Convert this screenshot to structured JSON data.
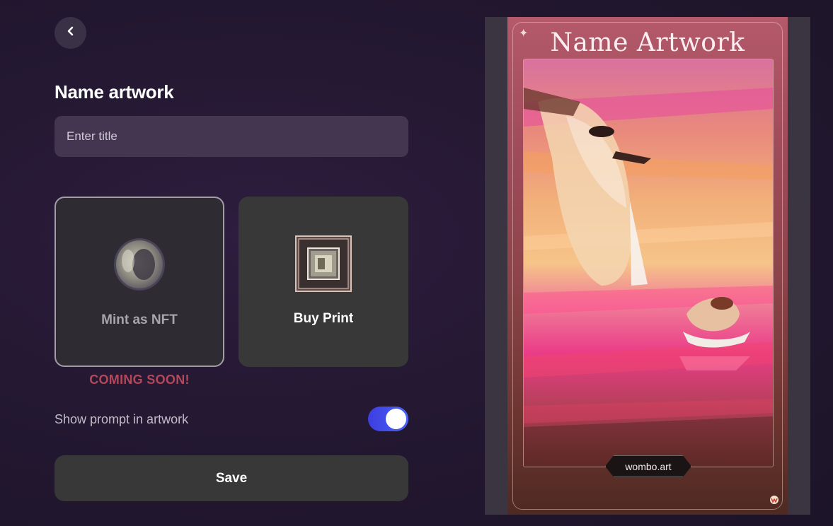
{
  "header": {
    "back_icon": "chevron-left-icon",
    "title": "Name artwork"
  },
  "title_input": {
    "placeholder": "Enter title",
    "value": ""
  },
  "options": {
    "nft": {
      "label": "Mint as NFT",
      "icon": "coin-icon",
      "badge": "COMING SOON!"
    },
    "print": {
      "label": "Buy Print",
      "icon": "picture-frame-icon"
    }
  },
  "prompt_toggle": {
    "label": "Show prompt in artwork",
    "enabled": true
  },
  "save_button": {
    "label": "Save"
  },
  "preview": {
    "title": "Name Artwork",
    "watermark": "wombo.art",
    "logo_icon": "wombo-logo-icon",
    "corner_icon": "sparkle-icon"
  },
  "colors": {
    "accent": "#4a63f5",
    "coming_soon": "#b3485a",
    "card_bg": "#383838",
    "input_bg": "#443651"
  }
}
